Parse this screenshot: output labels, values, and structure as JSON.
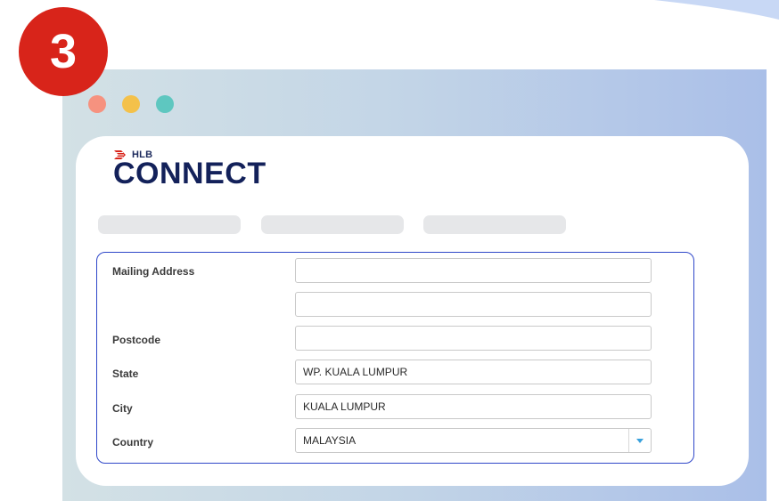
{
  "step": {
    "number": "3"
  },
  "brand": {
    "hlb": "HLB",
    "connect": "CONNECT"
  },
  "tabs": [
    {
      "label": ""
    },
    {
      "label": ""
    },
    {
      "label": ""
    }
  ],
  "form": {
    "mailing_address": {
      "label": "Mailing Address",
      "line1_value": "",
      "line2_value": ""
    },
    "postcode": {
      "label": "Postcode",
      "value": ""
    },
    "state": {
      "label": "State",
      "value": "WP. KUALA LUMPUR"
    },
    "city": {
      "label": "City",
      "value": "KUALA LUMPUR"
    },
    "country": {
      "label": "Country",
      "value": "MALAYSIA"
    }
  },
  "colors": {
    "badge": "#d8241a",
    "form_border": "#2f47c9",
    "brand_navy": "#13215a",
    "brand_red": "#d8241a",
    "dropdown_arrow": "#3aa1dc"
  },
  "icons": {
    "traffic_lights": [
      "close-dot",
      "minimize-dot",
      "maximize-dot"
    ],
    "dropdown": "caret-down-icon"
  }
}
